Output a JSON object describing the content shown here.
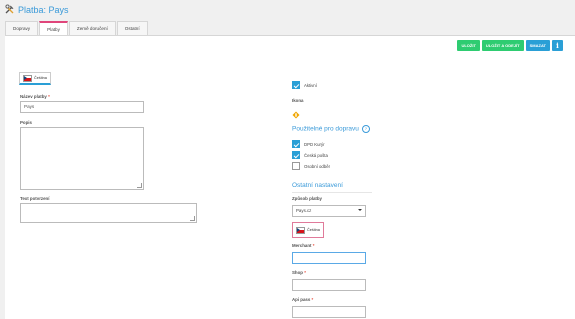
{
  "header": {
    "title": "Platba: Pays"
  },
  "tabs": [
    {
      "label": "Dopravy"
    },
    {
      "label": "Platby"
    },
    {
      "label": "Země doručení"
    },
    {
      "label": "Ostatní"
    }
  ],
  "toolbar": {
    "save": "ULOŽIT",
    "save_leave": "ULOŽIT A ODEJÍT",
    "delete": "SMAZAT",
    "info": "i"
  },
  "language": {
    "label": "Čeština"
  },
  "form": {
    "name_label": "Název platby",
    "name_required": "*",
    "name_value": "Pays",
    "desc_label": "Popis",
    "confirm_label": "Text potvrzení"
  },
  "right": {
    "active_label": "Aktivní",
    "icon_label": "Ikona",
    "shipping_title": "Použitelné pro dopravu",
    "shipping_help": "?",
    "shipping": [
      {
        "label": "DPD Kurýr",
        "checked": true
      },
      {
        "label": "Česká pošta",
        "checked": true
      },
      {
        "label": "Osobní odběr",
        "checked": false
      }
    ],
    "other_title": "Ostatní nastavení",
    "method_label": "Způsob platby",
    "method_value": "Pays.cz",
    "lang_label": "Čeština",
    "merchant_label": "Merchant",
    "shop_label": "Shop",
    "apipass_label": "Api pass",
    "required": "*"
  },
  "colors": {
    "accent": "#3a9ad9",
    "green": "#2ecc71",
    "blue": "#2a9fd6",
    "tab_active": "#e0457b"
  }
}
